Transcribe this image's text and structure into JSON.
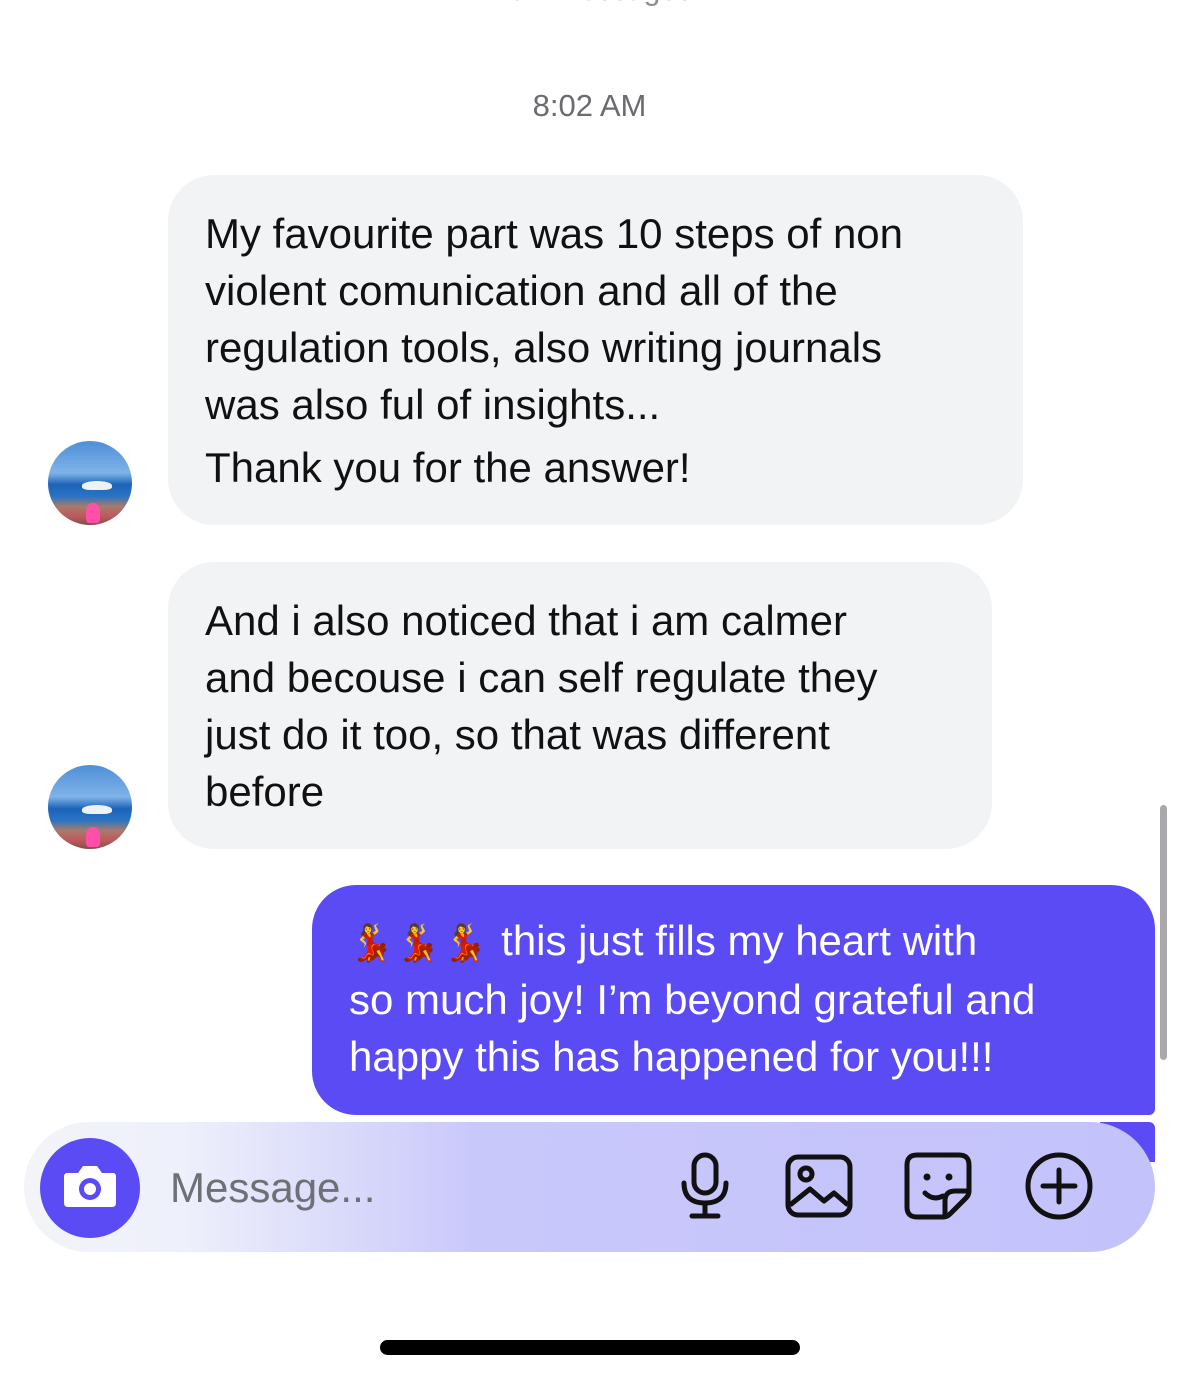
{
  "header": {
    "new_messages_label": "New Messages",
    "timestamp": "8:02 AM"
  },
  "messages": [
    {
      "sender": "contact",
      "lines": [
        "My favourite part was 10 steps of non",
        "violent comunication and all of the",
        "regulation tools, also writing journals",
        "was also ful of insights...",
        "Thank you for the answer!"
      ]
    },
    {
      "sender": "contact",
      "lines": [
        "And i also noticed that i am calmer",
        "and becouse i can self regulate they",
        "just do it too, so that was different",
        "before"
      ]
    },
    {
      "sender": "me",
      "emoji": "💃💃💃",
      "lines": [
        "this just fills my heart with",
        "so much joy! I’m beyond grateful and",
        "happy this has happened for you!!!"
      ]
    }
  ],
  "composer": {
    "placeholder": "Message...",
    "camera_icon": "camera-icon",
    "tools": [
      "microphone-icon",
      "image-icon",
      "sticker-icon",
      "plus-circle-icon"
    ]
  },
  "colors": {
    "accent": "#5a4bf5",
    "incoming_bubble": "#f2f3f5",
    "timestamp": "#6b6b70"
  }
}
